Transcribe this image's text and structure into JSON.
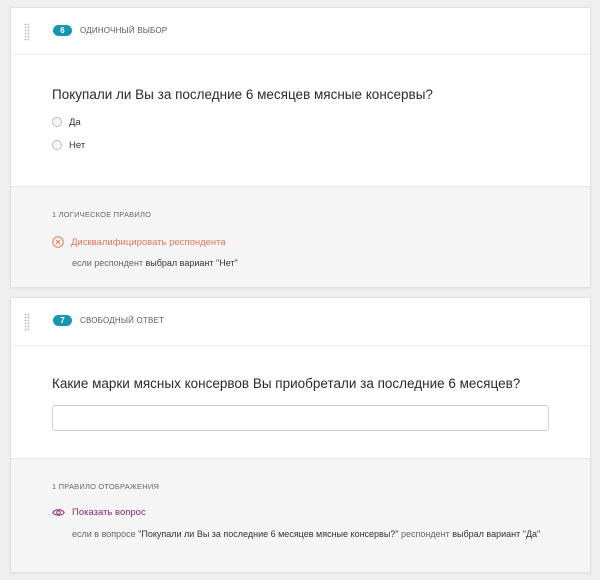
{
  "questions": [
    {
      "number": "6",
      "type": "ОДИНОЧНЫЙ ВЫБОР",
      "title": "Покупали ли Вы за последние 6 месяцев мясные консервы?",
      "options": [
        "Да",
        "Нет"
      ],
      "rules_title": "1 ЛОГИЧЕСКОЕ ПРАВИЛО",
      "rule_action": "Дисквалифицировать респондента",
      "rule_cond_prefix": "если респондент",
      "rule_cond_main": "выбрал вариант \"Нет\""
    },
    {
      "number": "7",
      "type": "СВОБОДНЫЙ ОТВЕТ",
      "title": "Какие марки мясных консервов Вы приобретали за последние 6 месяцев?",
      "answer_value": "",
      "rules_title": "1 ПРАВИЛО ОТОБРАЖЕНИЯ",
      "rule_action": "Показать вопрос",
      "rule_cond_prefix": "если в вопросе",
      "rule_cond_question": "\"Покупали ли Вы за последние 6 месяцев мясные консервы?\"",
      "rule_cond_mid": "респондент",
      "rule_cond_main": "выбрал вариант \"Да\""
    }
  ],
  "colors": {
    "badge": "#1697b1",
    "disqualify": "#e8755a",
    "show": "#8b2b73"
  },
  "icons": {
    "drag": "drag-handle-icon",
    "disqualify": "close-circle-icon",
    "show": "eye-icon"
  }
}
